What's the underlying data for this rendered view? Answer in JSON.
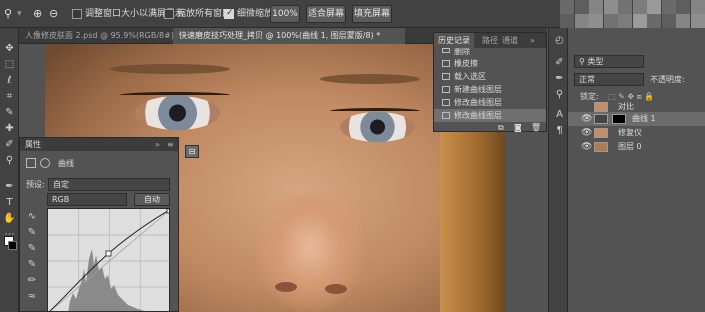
{
  "options_bar": {
    "zoom_icon": "magnifier-icon",
    "resize_windows_label": "调整窗口大小以满屏显示",
    "resize_windows_checked": false,
    "zoom_all_label": "缩放所有窗口",
    "zoom_all_checked": false,
    "scrubby_label": "细微缩放",
    "scrubby_checked": true,
    "percent_btn": "100%",
    "fit_btn": "适合屏幕",
    "fill_btn": "填充屏幕"
  },
  "doc_tabs": [
    {
      "label": "人像修皮肤面 2.psd @ 95.9%(RGB/8#)",
      "active": false
    },
    {
      "label": "快速磨皮技巧处理_拷贝 @ 100%(曲线 1, 图层蒙版/8) *",
      "active": true
    }
  ],
  "properties_panel": {
    "title": "属性",
    "subtitle": "曲线",
    "preset_label": "预设:",
    "preset_value": "自定",
    "channel_value": "RGB",
    "auto_btn": "自动"
  },
  "history_panel": {
    "tabs": [
      "历史记录",
      "路径",
      "通道"
    ],
    "items": [
      {
        "label": "删除",
        "selected": false
      },
      {
        "label": "橡皮擦",
        "selected": false
      },
      {
        "label": "载入选区",
        "selected": false
      },
      {
        "label": "新建曲线图层",
        "selected": false
      },
      {
        "label": "修改曲线图层",
        "selected": false
      },
      {
        "label": "修改曲线图层",
        "selected": true
      }
    ]
  },
  "layers_panel": {
    "filter_value": "类型",
    "blend_mode": "正常",
    "opacity_label": "不透明度:",
    "lock_label": "锁定:",
    "layers": [
      {
        "name": "对比",
        "selected": false,
        "visible": false
      },
      {
        "name": "曲线 1",
        "selected": true,
        "visible": true
      },
      {
        "name": "修复仪",
        "selected": false,
        "visible": true
      },
      {
        "name": "图层 0",
        "selected": false,
        "visible": true
      }
    ]
  },
  "colors": {
    "ui_dark": "#424242",
    "ui_mid": "#535353",
    "selected_row": "#6b6b6b",
    "skin": "#c08a63"
  }
}
